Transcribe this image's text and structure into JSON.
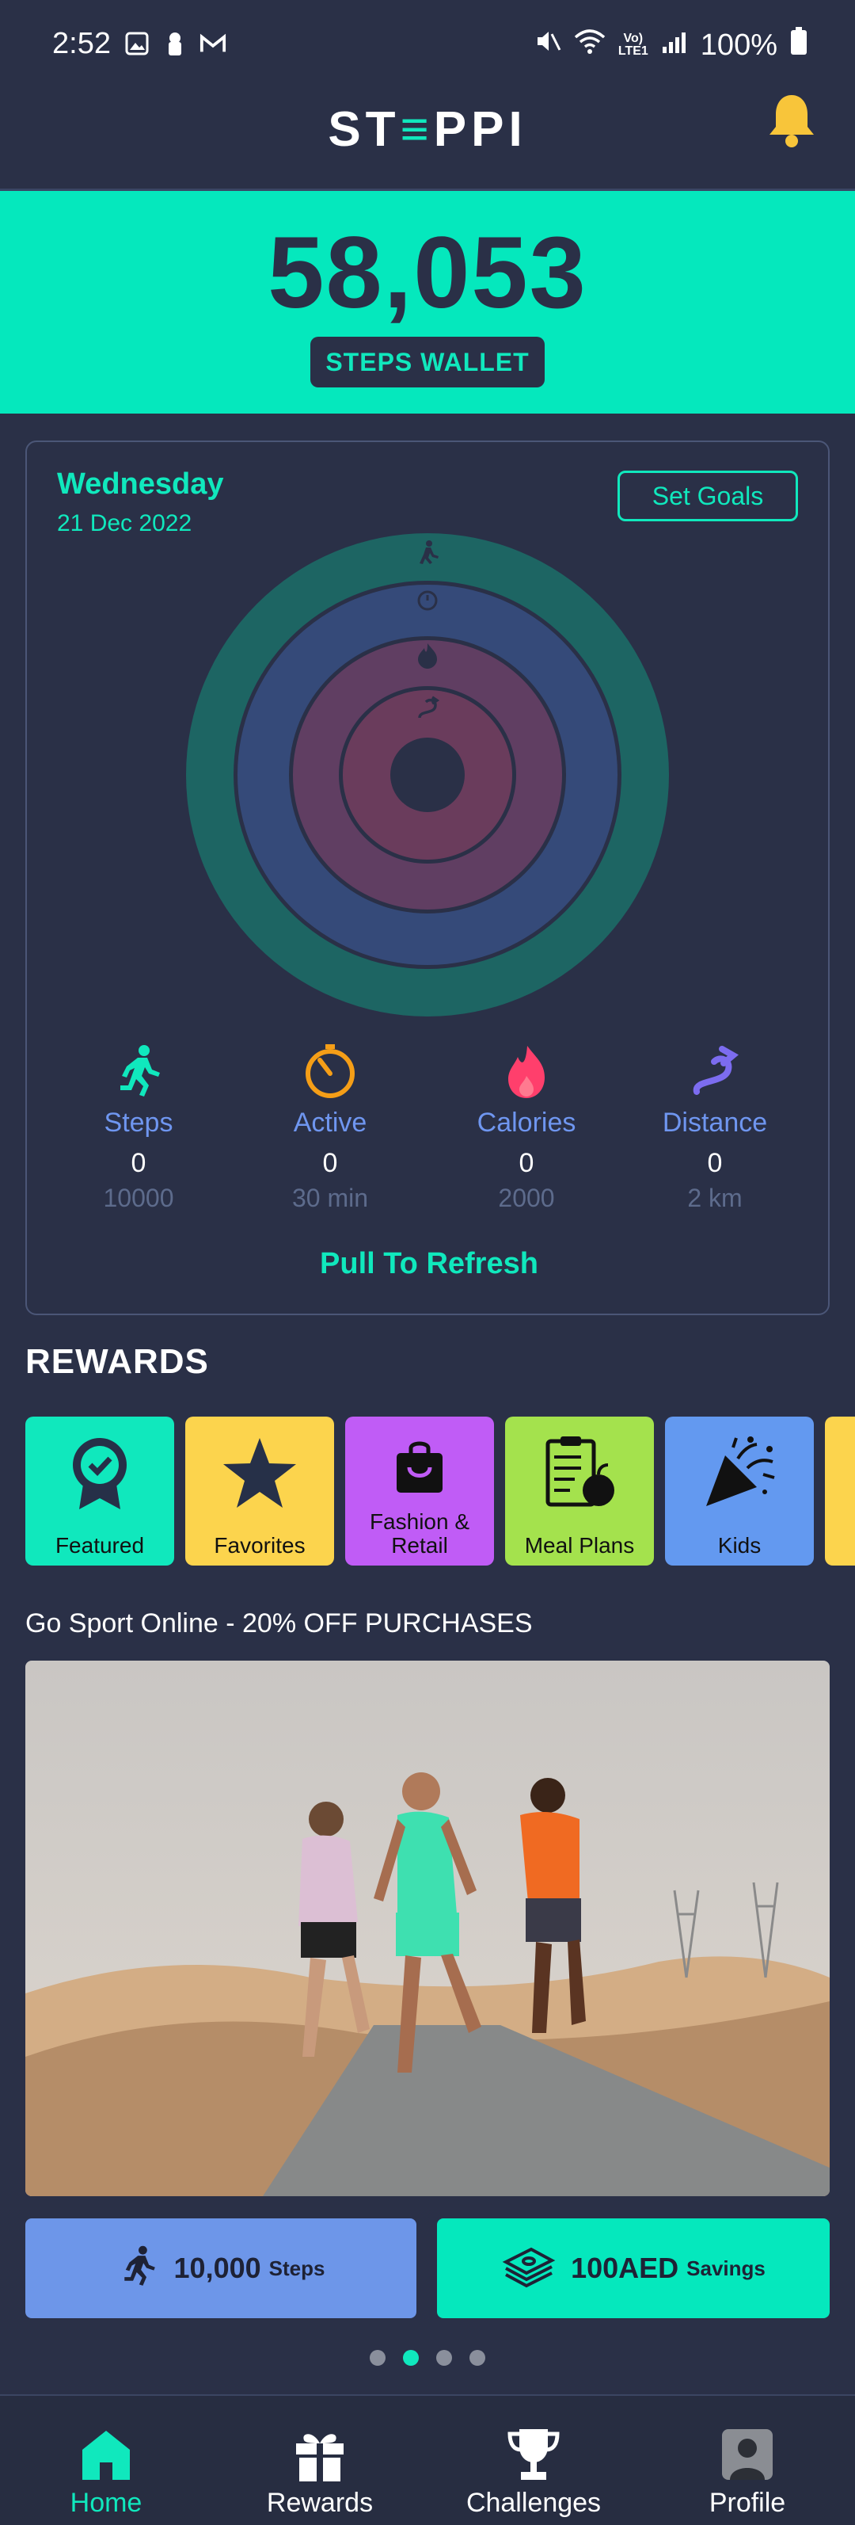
{
  "status_bar": {
    "time": "2:52",
    "battery": "100%",
    "network": "VoLTE1"
  },
  "header": {
    "logo": "STEPPI"
  },
  "wallet": {
    "steps": "58,053",
    "label": "STEPS WALLET"
  },
  "activity": {
    "day": "Wednesday",
    "date": "21 Dec 2022",
    "set_goals": "Set Goals",
    "stats": [
      {
        "label": "Steps",
        "value": "0",
        "goal": "10000",
        "color": "#10e8bd",
        "icon": "running-person-icon"
      },
      {
        "label": "Active",
        "value": "0",
        "goal": "30 min",
        "color": "#f59e17",
        "icon": "timer-icon"
      },
      {
        "label": "Calories",
        "value": "0",
        "goal": "2000",
        "color": "#ff3f6c",
        "icon": "flame-icon"
      },
      {
        "label": "Distance",
        "value": "0",
        "goal": "2 km",
        "color": "#7c6cf0",
        "icon": "route-icon"
      }
    ],
    "pull_to_refresh": "Pull To Refresh"
  },
  "rewards": {
    "title": "REWARDS",
    "tiles": [
      {
        "label": "Featured",
        "color": "#10e8bd",
        "icon": "badge-check-icon"
      },
      {
        "label": "Favorites",
        "color": "#fcd44d",
        "icon": "star-icon"
      },
      {
        "label": "Fashion & Retail",
        "color": "#c05cf6",
        "icon": "shopping-bag-icon"
      },
      {
        "label": "Meal Plans",
        "color": "#a4e24d",
        "icon": "clipboard-apple-icon"
      },
      {
        "label": "Kids",
        "color": "#6399f0",
        "icon": "party-popper-icon"
      }
    ]
  },
  "promo": {
    "title": "Go Sport Online - 20% OFF PURCHASES",
    "steps_value": "10,000",
    "steps_label": "Steps",
    "savings_value": "100AED",
    "savings_label": "Savings",
    "carousel_active": 2,
    "carousel_total": 4
  },
  "nav": {
    "home": "Home",
    "rewards": "Rewards",
    "challenges": "Challenges",
    "profile": "Profile"
  }
}
